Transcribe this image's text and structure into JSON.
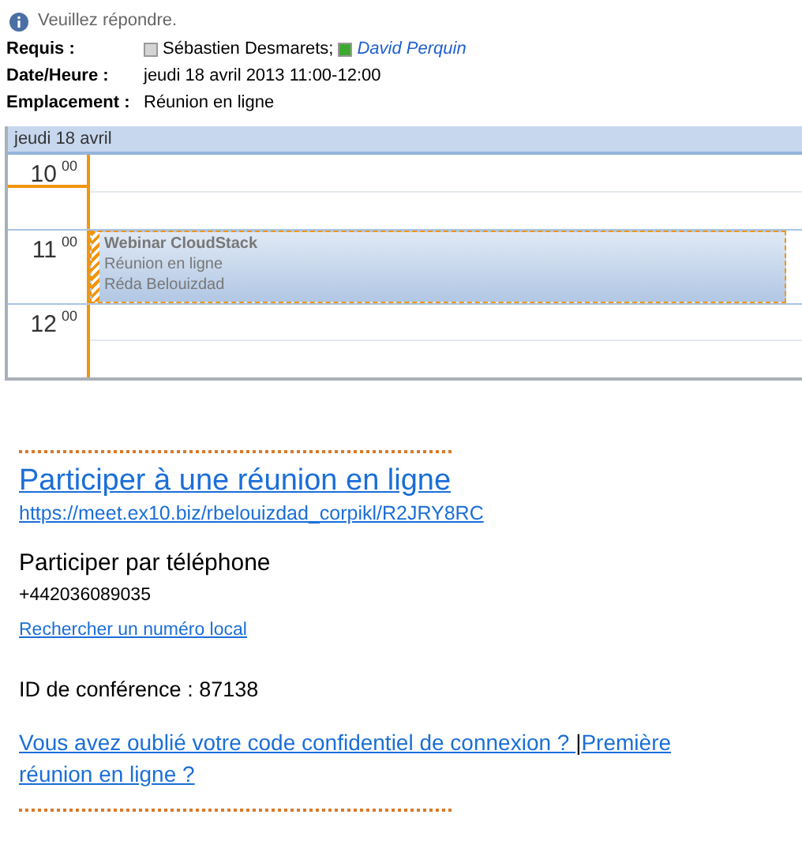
{
  "info_bar": {
    "text": "Veuillez répondre."
  },
  "fields": [
    {
      "label": "Requis :",
      "kind": "attendees",
      "attendees": [
        {
          "name": "Sébastien Desmarets;",
          "color": "#d4d4d4",
          "kind": "plain"
        },
        {
          "name": "David Perquin",
          "color": "#3daa2f",
          "kind": "link"
        }
      ]
    },
    {
      "label": "Date/Heure :",
      "kind": "text",
      "value": "jeudi 18 avril 2013 11:00-12:00"
    },
    {
      "label": "Emplacement :",
      "kind": "text",
      "value": "Réunion en ligne"
    }
  ],
  "calendar": {
    "day_header": "jeudi 18 avril",
    "hours": [
      {
        "hour": "10",
        "minutes": "00",
        "current": true
      },
      {
        "hour": "11",
        "minutes": "00",
        "current": false,
        "event": {
          "title": "Webinar CloudStack",
          "location": "Réunion en ligne",
          "organizer": "Réda Belouizdad"
        }
      },
      {
        "hour": "12",
        "minutes": "00",
        "current": false
      }
    ]
  },
  "meeting": {
    "join_link": "Participer à une réunion en ligne",
    "url": "https://meet.ex10.biz/rbelouizdad_corpikl/R2JRY8RC",
    "phone_heading": "Participer par téléphone",
    "phone": "+442036089035",
    "local_number_link": "Rechercher un numéro local",
    "conference_id": "ID de conférence : 87138",
    "forgot_pin_link": "Vous avez oublié votre code confidentiel de connexion ? ",
    "separator": "|",
    "first_meeting_link": "Première réunion en ligne ?"
  }
}
